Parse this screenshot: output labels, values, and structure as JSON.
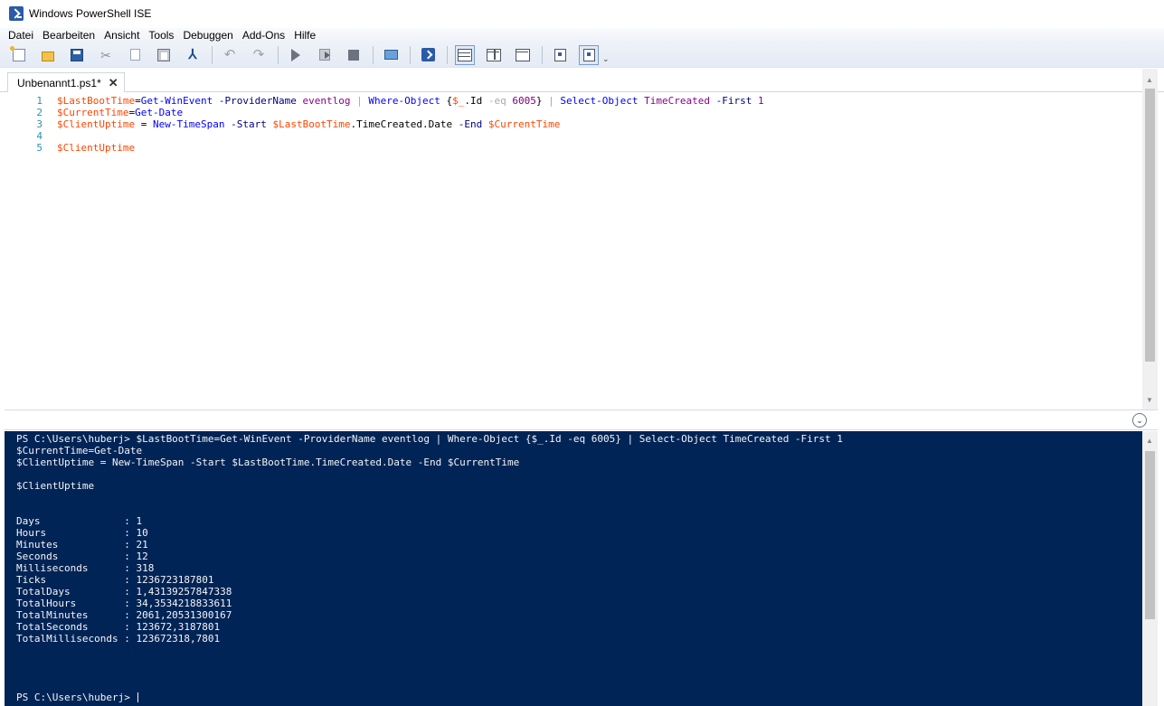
{
  "window": {
    "title": "Windows PowerShell ISE"
  },
  "menu": [
    "Datei",
    "Bearbeiten",
    "Ansicht",
    "Tools",
    "Debuggen",
    "Add-Ons",
    "Hilfe"
  ],
  "tab": {
    "label": "Unbenannt1.ps1*",
    "close": "✕"
  },
  "script": {
    "line_numbers": [
      "1",
      "2",
      "3",
      "4",
      "5"
    ],
    "lines": [
      [
        {
          "t": "$LastBootTime",
          "c": "c-var"
        },
        {
          "t": "=",
          "c": "c-plain"
        },
        {
          "t": "Get-WinEvent",
          "c": "c-cmd"
        },
        {
          "t": " ",
          "c": "c-plain"
        },
        {
          "t": "-ProviderName",
          "c": "c-param"
        },
        {
          "t": " ",
          "c": "c-plain"
        },
        {
          "t": "eventlog",
          "c": "c-str"
        },
        {
          "t": " | ",
          "c": "c-op"
        },
        {
          "t": "Where-Object",
          "c": "c-cmd"
        },
        {
          "t": " {",
          "c": "c-plain"
        },
        {
          "t": "$_",
          "c": "c-var"
        },
        {
          "t": ".Id ",
          "c": "c-plain"
        },
        {
          "t": "-eq",
          "c": "c-op"
        },
        {
          "t": " ",
          "c": "c-plain"
        },
        {
          "t": "6005",
          "c": "c-num"
        },
        {
          "t": "} ",
          "c": "c-plain"
        },
        {
          "t": "| ",
          "c": "c-op"
        },
        {
          "t": "Select-Object",
          "c": "c-cmd"
        },
        {
          "t": " ",
          "c": "c-plain"
        },
        {
          "t": "TimeCreated",
          "c": "c-str"
        },
        {
          "t": " ",
          "c": "c-plain"
        },
        {
          "t": "-First",
          "c": "c-param"
        },
        {
          "t": " ",
          "c": "c-plain"
        },
        {
          "t": "1",
          "c": "c-num"
        }
      ],
      [
        {
          "t": "$CurrentTime",
          "c": "c-var"
        },
        {
          "t": "=",
          "c": "c-plain"
        },
        {
          "t": "Get-Date",
          "c": "c-cmd"
        }
      ],
      [
        {
          "t": "$ClientUptime",
          "c": "c-var"
        },
        {
          "t": " = ",
          "c": "c-plain"
        },
        {
          "t": "New-TimeSpan",
          "c": "c-cmd"
        },
        {
          "t": " ",
          "c": "c-plain"
        },
        {
          "t": "-Start",
          "c": "c-param"
        },
        {
          "t": " ",
          "c": "c-plain"
        },
        {
          "t": "$LastBootTime",
          "c": "c-var"
        },
        {
          "t": ".TimeCreated.Date ",
          "c": "c-plain"
        },
        {
          "t": "-End",
          "c": "c-param"
        },
        {
          "t": " ",
          "c": "c-plain"
        },
        {
          "t": "$CurrentTime",
          "c": "c-var"
        }
      ],
      [],
      [
        {
          "t": "$ClientUptime",
          "c": "c-var"
        }
      ]
    ]
  },
  "console": {
    "lines": [
      "PS C:\\Users\\huberj> $LastBootTime=Get-WinEvent -ProviderName eventlog | Where-Object {$_.Id -eq 6005} | Select-Object TimeCreated -First 1",
      "$CurrentTime=Get-Date",
      "$ClientUptime = New-TimeSpan -Start $LastBootTime.TimeCreated.Date -End $CurrentTime",
      "",
      "$ClientUptime",
      "",
      "",
      "Days              : 1",
      "Hours             : 10",
      "Minutes           : 21",
      "Seconds           : 12",
      "Milliseconds      : 318",
      "Ticks             : 1236723187801",
      "TotalDays         : 1,43139257847338",
      "TotalHours        : 34,3534218833611",
      "TotalMinutes      : 2061,20531300167",
      "TotalSeconds      : 123672,3187801",
      "TotalMilliseconds : 123672318,7801"
    ],
    "prompt": "PS C:\\Users\\huberj> "
  },
  "icons": {
    "tab_collapse": "⌃",
    "pane_expand": "⌄",
    "toolbar_more": "⌄"
  }
}
